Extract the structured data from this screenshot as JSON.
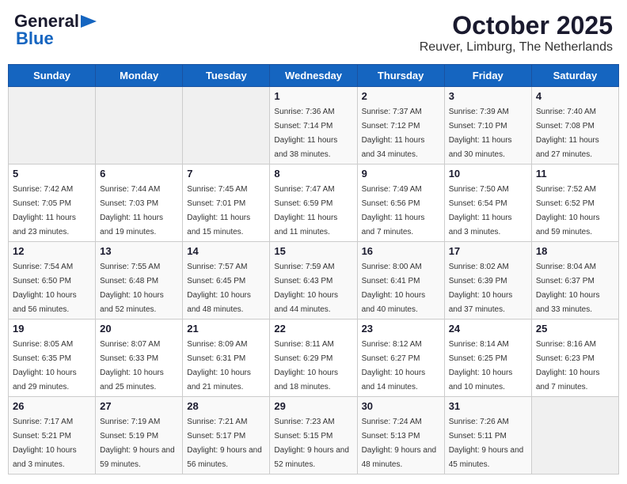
{
  "header": {
    "logo_line1": "General",
    "logo_line2": "Blue",
    "title": "October 2025",
    "subtitle": "Reuver, Limburg, The Netherlands"
  },
  "days_of_week": [
    "Sunday",
    "Monday",
    "Tuesday",
    "Wednesday",
    "Thursday",
    "Friday",
    "Saturday"
  ],
  "weeks": [
    {
      "row_class": "row-bg-light",
      "days": [
        {
          "num": "",
          "empty": true
        },
        {
          "num": "",
          "empty": true
        },
        {
          "num": "",
          "empty": true
        },
        {
          "num": "1",
          "rise": "7:36 AM",
          "set": "7:14 PM",
          "daylight": "11 hours and 38 minutes."
        },
        {
          "num": "2",
          "rise": "7:37 AM",
          "set": "7:12 PM",
          "daylight": "11 hours and 34 minutes."
        },
        {
          "num": "3",
          "rise": "7:39 AM",
          "set": "7:10 PM",
          "daylight": "11 hours and 30 minutes."
        },
        {
          "num": "4",
          "rise": "7:40 AM",
          "set": "7:08 PM",
          "daylight": "11 hours and 27 minutes."
        }
      ]
    },
    {
      "row_class": "row-bg-white",
      "days": [
        {
          "num": "5",
          "rise": "7:42 AM",
          "set": "7:05 PM",
          "daylight": "11 hours and 23 minutes."
        },
        {
          "num": "6",
          "rise": "7:44 AM",
          "set": "7:03 PM",
          "daylight": "11 hours and 19 minutes."
        },
        {
          "num": "7",
          "rise": "7:45 AM",
          "set": "7:01 PM",
          "daylight": "11 hours and 15 minutes."
        },
        {
          "num": "8",
          "rise": "7:47 AM",
          "set": "6:59 PM",
          "daylight": "11 hours and 11 minutes."
        },
        {
          "num": "9",
          "rise": "7:49 AM",
          "set": "6:56 PM",
          "daylight": "11 hours and 7 minutes."
        },
        {
          "num": "10",
          "rise": "7:50 AM",
          "set": "6:54 PM",
          "daylight": "11 hours and 3 minutes."
        },
        {
          "num": "11",
          "rise": "7:52 AM",
          "set": "6:52 PM",
          "daylight": "10 hours and 59 minutes."
        }
      ]
    },
    {
      "row_class": "row-bg-light",
      "days": [
        {
          "num": "12",
          "rise": "7:54 AM",
          "set": "6:50 PM",
          "daylight": "10 hours and 56 minutes."
        },
        {
          "num": "13",
          "rise": "7:55 AM",
          "set": "6:48 PM",
          "daylight": "10 hours and 52 minutes."
        },
        {
          "num": "14",
          "rise": "7:57 AM",
          "set": "6:45 PM",
          "daylight": "10 hours and 48 minutes."
        },
        {
          "num": "15",
          "rise": "7:59 AM",
          "set": "6:43 PM",
          "daylight": "10 hours and 44 minutes."
        },
        {
          "num": "16",
          "rise": "8:00 AM",
          "set": "6:41 PM",
          "daylight": "10 hours and 40 minutes."
        },
        {
          "num": "17",
          "rise": "8:02 AM",
          "set": "6:39 PM",
          "daylight": "10 hours and 37 minutes."
        },
        {
          "num": "18",
          "rise": "8:04 AM",
          "set": "6:37 PM",
          "daylight": "10 hours and 33 minutes."
        }
      ]
    },
    {
      "row_class": "row-bg-white",
      "days": [
        {
          "num": "19",
          "rise": "8:05 AM",
          "set": "6:35 PM",
          "daylight": "10 hours and 29 minutes."
        },
        {
          "num": "20",
          "rise": "8:07 AM",
          "set": "6:33 PM",
          "daylight": "10 hours and 25 minutes."
        },
        {
          "num": "21",
          "rise": "8:09 AM",
          "set": "6:31 PM",
          "daylight": "10 hours and 21 minutes."
        },
        {
          "num": "22",
          "rise": "8:11 AM",
          "set": "6:29 PM",
          "daylight": "10 hours and 18 minutes."
        },
        {
          "num": "23",
          "rise": "8:12 AM",
          "set": "6:27 PM",
          "daylight": "10 hours and 14 minutes."
        },
        {
          "num": "24",
          "rise": "8:14 AM",
          "set": "6:25 PM",
          "daylight": "10 hours and 10 minutes."
        },
        {
          "num": "25",
          "rise": "8:16 AM",
          "set": "6:23 PM",
          "daylight": "10 hours and 7 minutes."
        }
      ]
    },
    {
      "row_class": "row-bg-light",
      "days": [
        {
          "num": "26",
          "rise": "7:17 AM",
          "set": "5:21 PM",
          "daylight": "10 hours and 3 minutes."
        },
        {
          "num": "27",
          "rise": "7:19 AM",
          "set": "5:19 PM",
          "daylight": "9 hours and 59 minutes."
        },
        {
          "num": "28",
          "rise": "7:21 AM",
          "set": "5:17 PM",
          "daylight": "9 hours and 56 minutes."
        },
        {
          "num": "29",
          "rise": "7:23 AM",
          "set": "5:15 PM",
          "daylight": "9 hours and 52 minutes."
        },
        {
          "num": "30",
          "rise": "7:24 AM",
          "set": "5:13 PM",
          "daylight": "9 hours and 48 minutes."
        },
        {
          "num": "31",
          "rise": "7:26 AM",
          "set": "5:11 PM",
          "daylight": "9 hours and 45 minutes."
        },
        {
          "num": "",
          "empty": true
        }
      ]
    }
  ]
}
